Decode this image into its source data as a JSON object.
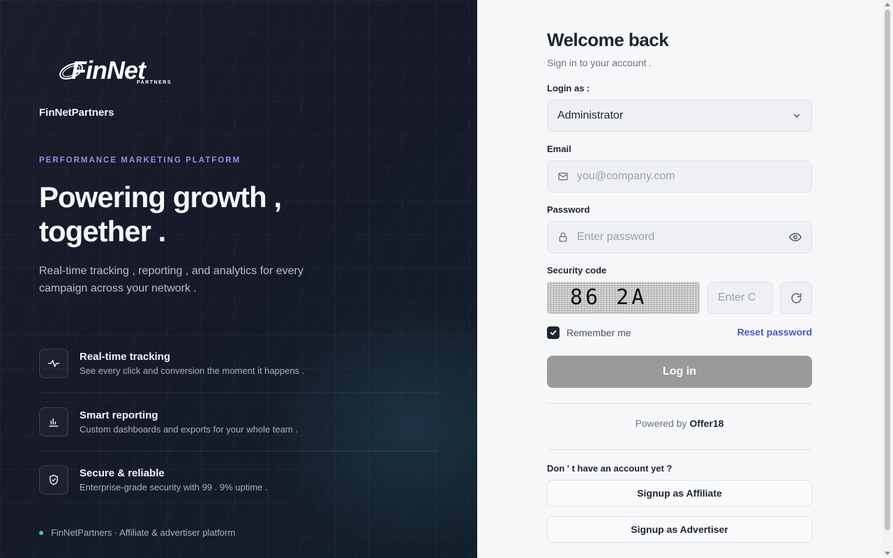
{
  "brand": {
    "logo_text": "FinNet",
    "logo_sub": "PARTNERS",
    "name": "FinNetPartners"
  },
  "hero": {
    "eyebrow": "PERFORMANCE MARKETING PLATFORM",
    "headline_line1": "Powering growth ,",
    "headline_line2": "together .",
    "lede": "Real-time tracking , reporting , and analytics for every campaign across your network ."
  },
  "features": [
    {
      "icon": "activity-icon",
      "title": "Real-time tracking",
      "desc": "See every click and conversion the moment it happens ."
    },
    {
      "icon": "bar-chart-icon",
      "title": "Smart reporting",
      "desc": "Custom dashboards and exports for your whole team ."
    },
    {
      "icon": "shield-check-icon",
      "title": "Secure & reliable",
      "desc": "Enterprise-grade security with 99 . 9% uptime ."
    }
  ],
  "footer_note": "FinNetPartners · Affiliate & advertiser platform",
  "form": {
    "title": "Welcome back",
    "subtitle": "Sign in to your account .",
    "login_as_label": "Login as :",
    "login_as_value": "Administrator",
    "email_label": "Email",
    "email_placeholder": "you@company.com",
    "password_label": "Password",
    "password_placeholder": "Enter password",
    "security_label": "Security code",
    "captcha_text": "86 2A",
    "captcha_placeholder": "Enter C",
    "remember_label": "Remember me",
    "remember_checked": true,
    "reset_label": "Reset password",
    "login_button": "Log in",
    "powered_prefix": "Powered by",
    "powered_brand": "Offer18",
    "no_account": "Don ' t have an account yet ?",
    "signup_affiliate": "Signup as Affiliate",
    "signup_advertiser": "Signup as Advertiser"
  },
  "colors": {
    "left_bg": "#171a27",
    "accent": "#8b95e8",
    "link": "#4a57c4",
    "login_disabled": "#9a9a9a",
    "status_dot": "#34d399"
  }
}
